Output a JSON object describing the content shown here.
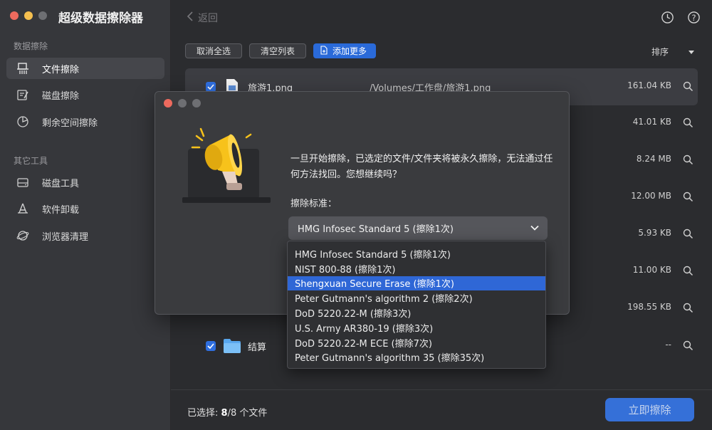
{
  "app": {
    "title": "超级数据擦除器"
  },
  "sidebar": {
    "section1": "数据擦除",
    "section2": "其它工具",
    "items": [
      {
        "label": "文件擦除",
        "icon": "file-shred-icon"
      },
      {
        "label": "磁盘擦除",
        "icon": "disk-erase-icon"
      },
      {
        "label": "剩余空间擦除",
        "icon": "pie-chart-icon"
      },
      {
        "label": "磁盘工具",
        "icon": "disk-tool-icon"
      },
      {
        "label": "软件卸载",
        "icon": "app-uninstall-icon"
      },
      {
        "label": "浏览器清理",
        "icon": "browser-clean-icon"
      }
    ]
  },
  "header": {
    "back_label": "返回",
    "history_icon": "clock-icon",
    "help_icon": "help-icon"
  },
  "toolbar": {
    "deselect_all": "取消全选",
    "clear_list": "清空列表",
    "add_more": "添加更多",
    "sort_label": "排序"
  },
  "files": [
    {
      "name": "旅游1.png",
      "path": "/Volumes/工作盘/旅游1.png",
      "size": "161.04 KB"
    },
    {
      "name": "",
      "path": "",
      "size": "41.01 KB"
    },
    {
      "name": "",
      "path": "",
      "size": "8.24 MB"
    },
    {
      "name": "",
      "path": "",
      "size": "12.00 MB"
    },
    {
      "name": "",
      "path": "",
      "size": "5.93 KB"
    },
    {
      "name": "",
      "path": "",
      "size": "11.00 KB"
    },
    {
      "name": "",
      "path": "",
      "size": "198.55 KB"
    },
    {
      "name": "结算",
      "path": "",
      "size": "--"
    }
  ],
  "bottom": {
    "selected_prefix": "已选择: ",
    "selected_count": "8",
    "selected_suffix": "/8 个文件",
    "erase_button": "立即擦除"
  },
  "dialog": {
    "message": "一旦开始擦除，已选定的文件/文件夹将被永久擦除，无法通过任何方法找回。您想继续吗？",
    "standard_label": "擦除标准：",
    "selected_standard": "HMG Infosec Standard 5 (擦除1次)",
    "options": [
      "HMG Infosec Standard 5 (擦除1次)",
      "NIST 800-88 (擦除1次)",
      "Shengxuan Secure Erase (擦除1次)",
      "Peter Gutmann's algorithm 2 (擦除2次)",
      "DoD 5220.22-M (擦除3次)",
      "U.S. Army AR380-19 (擦除3次)",
      "DoD 5220.22-M ECE (擦除7次)",
      "Peter Gutmann's algorithm 35 (擦除35次)"
    ],
    "highlighted_index": 2
  },
  "colors": {
    "accent": "#2f67d6",
    "close": "#ed6a5e",
    "minimize": "#f5bf4f",
    "zoom": "#62c554"
  }
}
